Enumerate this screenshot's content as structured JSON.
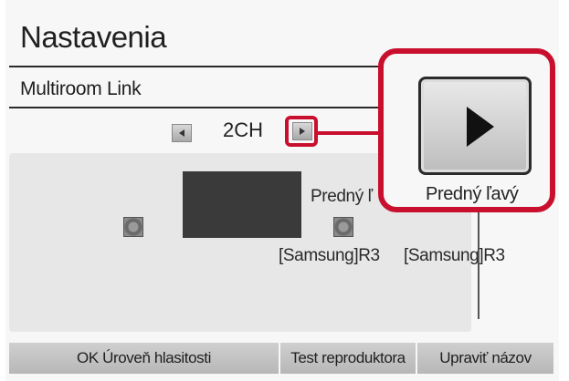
{
  "header": {
    "title": "Nastavenia",
    "subtitle": "Multiroom Link"
  },
  "channel": {
    "value": "2CH",
    "prev_icon": "arrow-left-icon",
    "next_icon": "arrow-right-icon"
  },
  "speakers": [
    {
      "label": "Predný ľ",
      "model": "[Samsung]R3",
      "icon": "speaker-icon"
    },
    {
      "label": "Predný ľavý",
      "model": "[Samsung]R3",
      "icon": "speaker-icon"
    }
  ],
  "zoom": {
    "label": "Predný ľavý",
    "icon": "play-icon"
  },
  "bottom_buttons": [
    {
      "label": "OK Úroveň hlasitosti"
    },
    {
      "label": "Test reproduktora"
    },
    {
      "label": "Upraviť názov"
    }
  ],
  "colors": {
    "highlight": "#c8102e",
    "screen_bg": "#f7f7f7",
    "panel_bg": "#e7e7e7",
    "button_bg": "#c4c4c4"
  }
}
